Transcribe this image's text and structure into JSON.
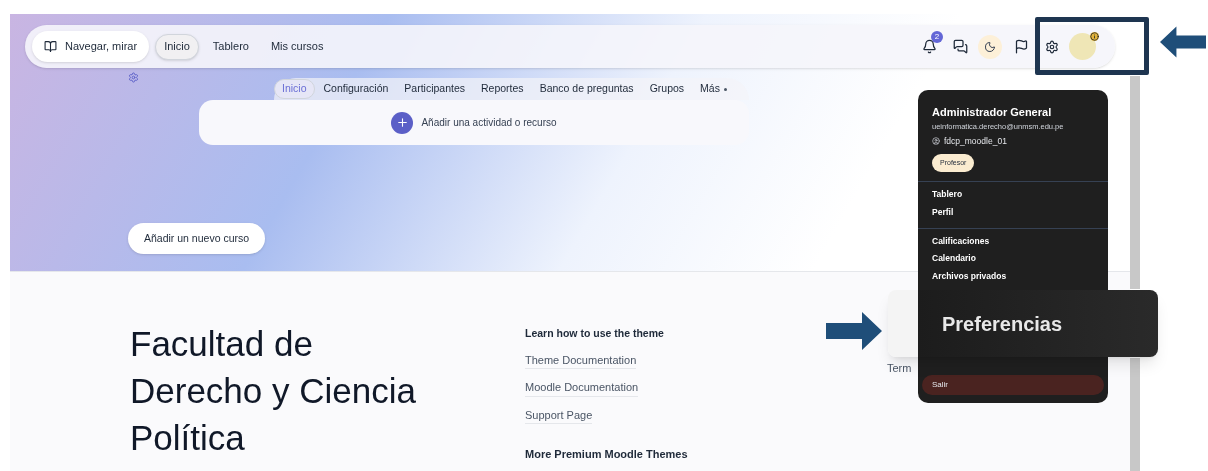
{
  "navbar": {
    "browse_button": "Navegar, mirar",
    "items": [
      {
        "label": "Inicio",
        "selected": true
      },
      {
        "label": "Tablero",
        "selected": false
      },
      {
        "label": "Mis cursos",
        "selected": false
      }
    ],
    "notification_count": "2"
  },
  "course_tabs": [
    {
      "label": "Inicio",
      "selected": true
    },
    {
      "label": "Configuración",
      "selected": false
    },
    {
      "label": "Participantes",
      "selected": false
    },
    {
      "label": "Reportes",
      "selected": false
    },
    {
      "label": "Banco de preguntas",
      "selected": false
    },
    {
      "label": "Grupos",
      "selected": false
    },
    {
      "label": "Más",
      "selected": false
    }
  ],
  "add_activity": "Añadir una actividad o recurso",
  "add_course_button": "Añadir un nuevo curso",
  "site_title": "Facultad de Derecho y Ciencia Política",
  "links_column": {
    "heading": "Learn how to use the theme",
    "links": [
      "Theme Documentation",
      "Moodle Documentation",
      "Support Page"
    ],
    "heading_2": "More Premium Moodle Themes"
  },
  "partial_text": "Term",
  "user_menu": {
    "name": "Administrador General",
    "email": "ueinformatica.derecho@unmsm.edu.pe",
    "username": "fdcp_moodle_01",
    "role": "Profesor",
    "sections": [
      [
        {
          "label": "Tablero",
          "kind": "link"
        },
        {
          "label": "Perfil",
          "kind": "link"
        }
      ],
      [
        {
          "label": "Calificaciones",
          "kind": "link"
        },
        {
          "label": "Calendario",
          "kind": "link"
        },
        {
          "label": "Archivos privados",
          "kind": "link"
        }
      ],
      [
        {
          "label": "Salir",
          "kind": "danger"
        }
      ]
    ]
  },
  "callout": "Preferencias"
}
